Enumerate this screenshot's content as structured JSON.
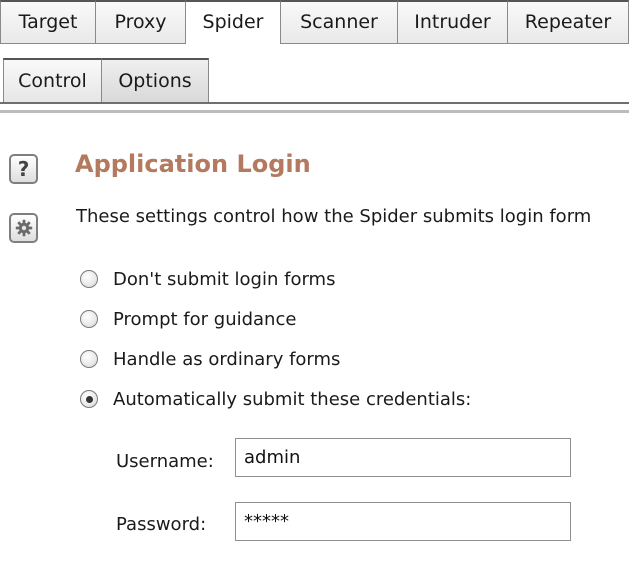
{
  "top_tabs": [
    {
      "label": "Target"
    },
    {
      "label": "Proxy"
    },
    {
      "label": "Spider"
    },
    {
      "label": "Scanner"
    },
    {
      "label": "Intruder"
    },
    {
      "label": "Repeater"
    }
  ],
  "active_top_tab": "Spider",
  "sub_tabs": [
    {
      "label": "Control"
    },
    {
      "label": "Options"
    }
  ],
  "active_sub_tab": "Options",
  "section": {
    "title": "Application Login",
    "description": "These settings control how the Spider submits login form",
    "help_icon": "question-mark-icon",
    "settings_icon": "gear-icon",
    "title_color": "#b47a5f"
  },
  "login_options": [
    {
      "label": "Don't submit login forms",
      "checked": false
    },
    {
      "label": "Prompt for guidance",
      "checked": false
    },
    {
      "label": "Handle as ordinary forms",
      "checked": false
    },
    {
      "label": "Automatically submit these credentials:",
      "checked": true
    }
  ],
  "credentials": {
    "username_label": "Username:",
    "username_value": "admin",
    "password_label": "Password:",
    "password_value": "*****"
  }
}
